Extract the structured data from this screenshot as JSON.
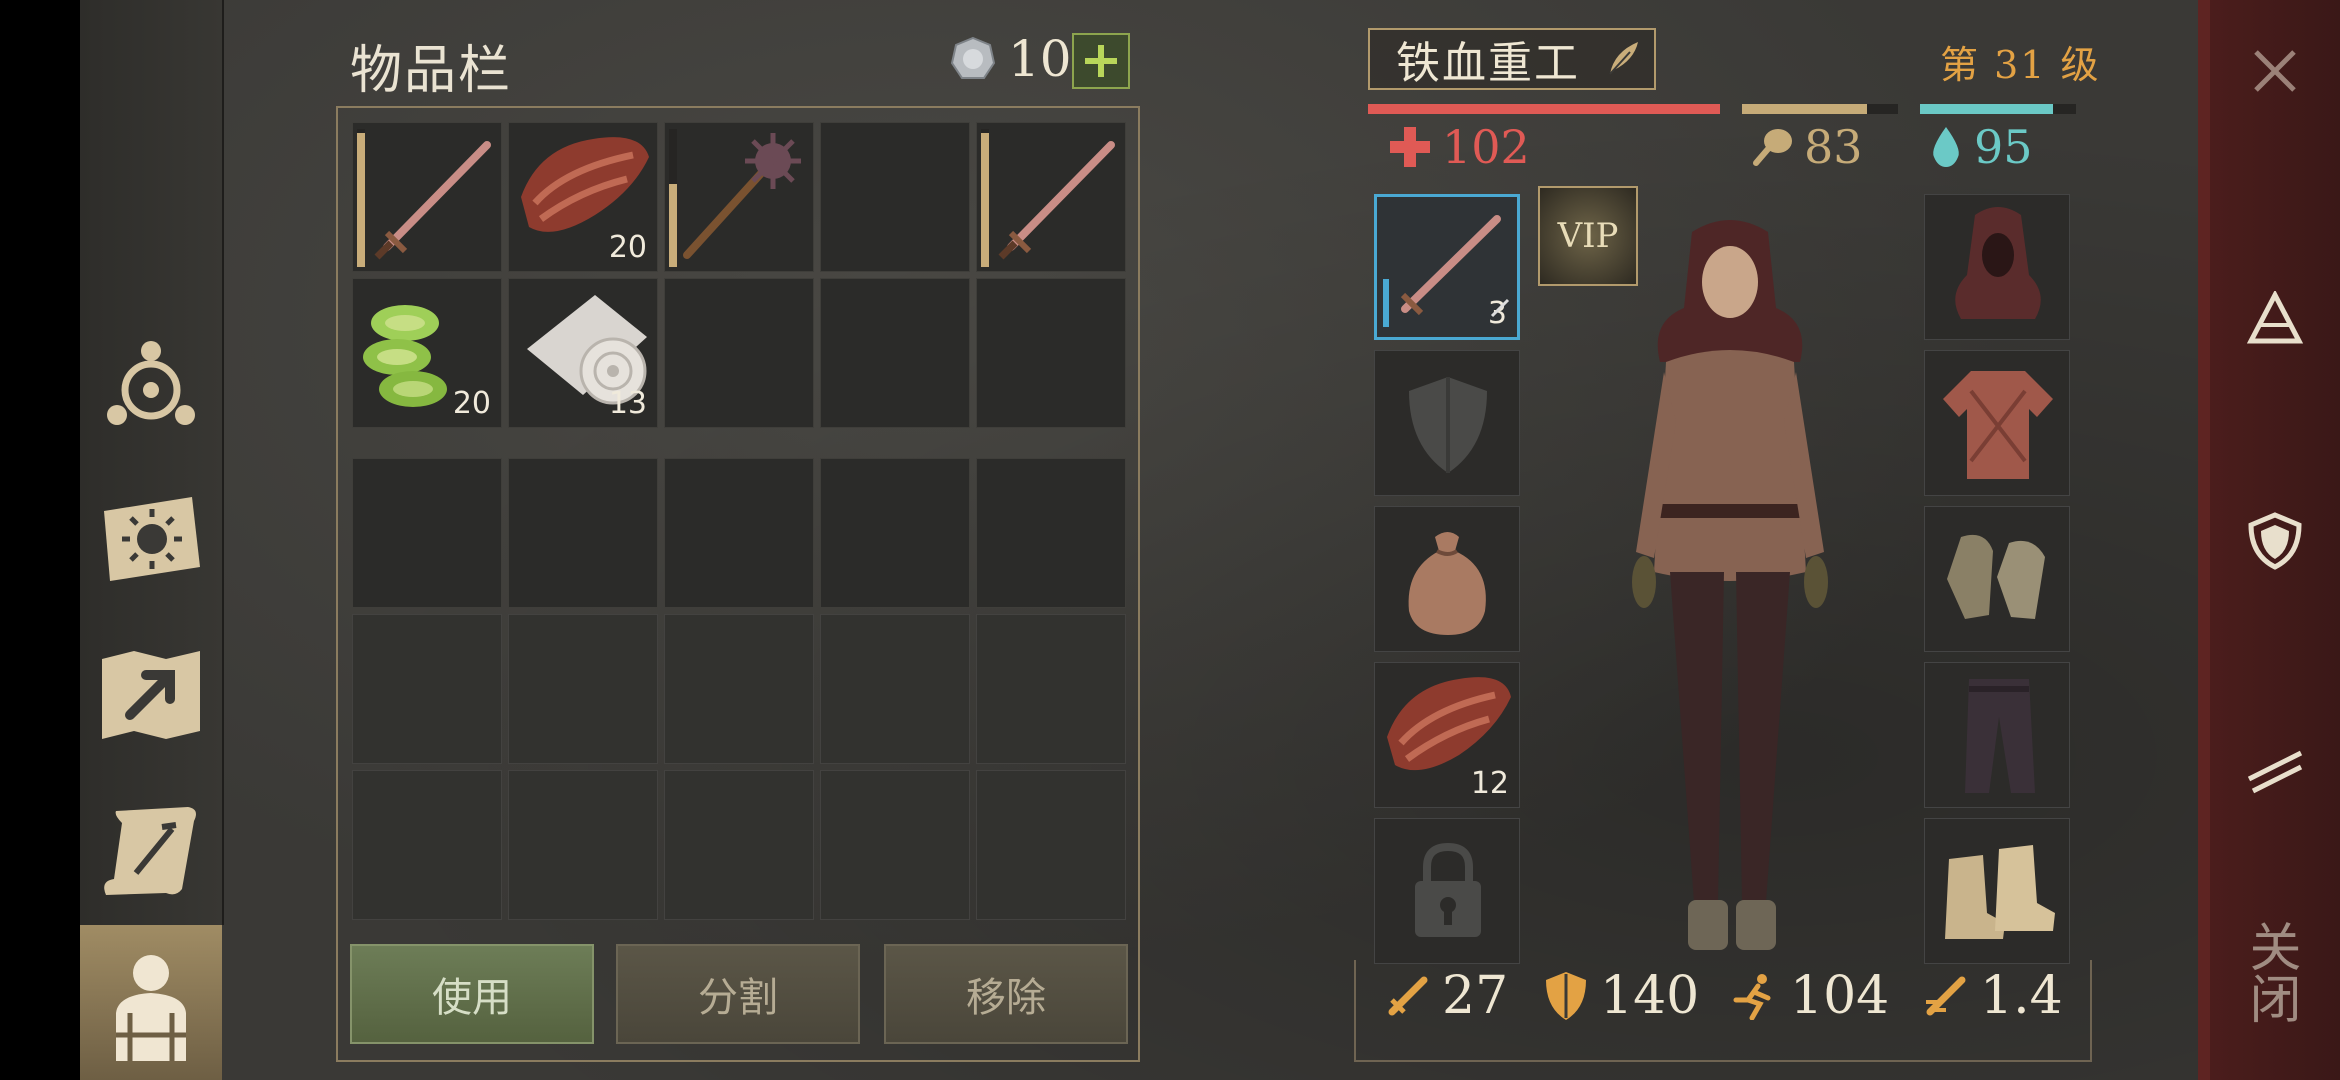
{
  "inventory": {
    "title": "物品栏",
    "currency": "10",
    "items": [
      {
        "icon": "sword-icon",
        "count": "",
        "durability": 0.97
      },
      {
        "icon": "meat-icon",
        "count": "20"
      },
      {
        "icon": "mace-icon",
        "count": "",
        "durability": 0.6
      },
      {
        "icon": "",
        "count": ""
      },
      {
        "icon": "sword-icon",
        "count": "",
        "durability": 0.97
      },
      {
        "icon": "cactus-slices-icon",
        "count": "20"
      },
      {
        "icon": "cloth-roll-icon",
        "count": "13"
      }
    ],
    "buttons": {
      "use": "使用",
      "split": "分割",
      "remove": "移除"
    }
  },
  "character": {
    "name": "铁血重工",
    "level": "第 31 级",
    "health": "102",
    "food": "83",
    "water": "95",
    "health_fill": 1.0,
    "food_fill": 0.8,
    "water_fill": 0.85,
    "weapon_count": "3",
    "food_slot_count": "12",
    "vip_label": "VIP",
    "stats": {
      "damage": "27",
      "armor": "140",
      "speed": "104",
      "weight": "1.4"
    }
  },
  "right_bar": {
    "close_label": "关闭"
  },
  "colors": {
    "health": "#e05a55",
    "food": "#c6ab78",
    "water": "#6bc9c6",
    "accent": "#e3a244"
  }
}
